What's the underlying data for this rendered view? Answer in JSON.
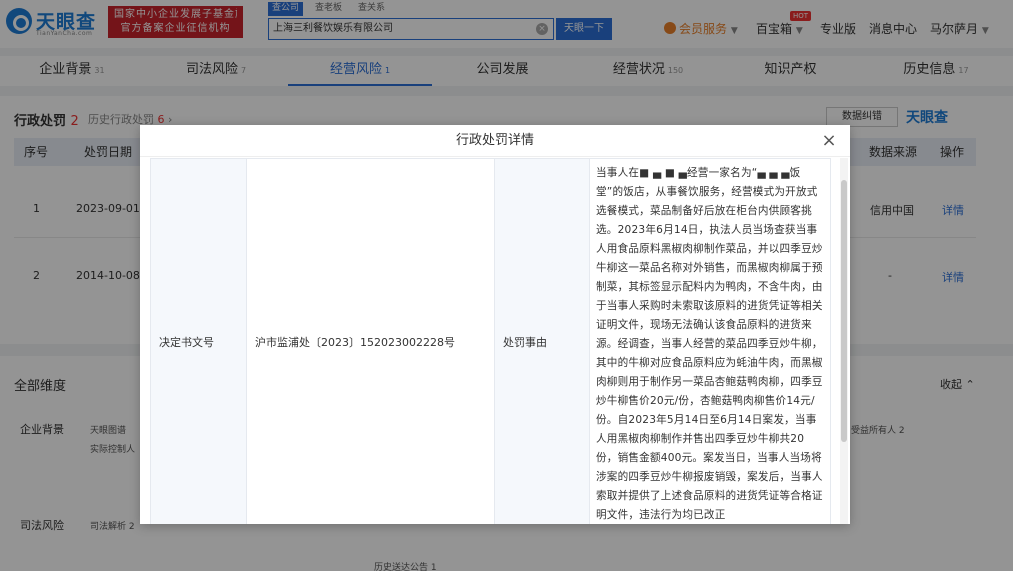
{
  "header": {
    "logo_text": "天眼查",
    "logo_sub": "TianYanCha.com",
    "banner_line1": "国家中小企业发展子基金旗下",
    "banner_line2": "官方备案企业征信机构",
    "search_tabs": [
      "查公司",
      "查老板",
      "查关系"
    ],
    "search_value": "上海三利餐饮娱乐有限公司",
    "search_button": "天眼一下",
    "vip_label": "会员服务",
    "treasure_label": "百宝箱",
    "hot_badge": "HOT",
    "pro_label": "专业版",
    "message_label": "消息中心",
    "user_name": "马尔萨月"
  },
  "main_tabs": [
    {
      "label": "企业背景",
      "count": "31"
    },
    {
      "label": "司法风险",
      "count": "7"
    },
    {
      "label": "经营风险",
      "count": "1"
    },
    {
      "label": "公司发展",
      "count": ""
    },
    {
      "label": "经营状况",
      "count": "150"
    },
    {
      "label": "知识产权",
      "count": ""
    },
    {
      "label": "历史信息",
      "count": "17"
    }
  ],
  "penalty_section": {
    "title": "行政处罚",
    "count": "2",
    "history_label": "历史行政处罚",
    "history_count": "6",
    "feedback_button": "数据纠错",
    "watermark": "天眼查",
    "columns": [
      "序号",
      "处罚日期",
      "数据来源",
      "操作"
    ],
    "rows": [
      {
        "index": "1",
        "date": "2023-09-01",
        "source": "信用中国",
        "action": "详情"
      },
      {
        "index": "2",
        "date": "2014-10-08",
        "source": "-",
        "action": "详情"
      }
    ]
  },
  "dimensions": {
    "title": "全部维度",
    "collapse_label": "收起",
    "categories": [
      "企业背景",
      "司法风险"
    ],
    "items_row1": [
      "天眼图谱",
      "实际控制人",
      "受益所有人 2"
    ],
    "items_row2": [
      "司法解析 2",
      "历史送达公告 1"
    ]
  },
  "modal": {
    "title": "行政处罚详情",
    "decision_label": "决定书文号",
    "decision_value": "沪市监浦处〔2023〕152023002228号",
    "reason_label": "处罚事由",
    "reason_text": "当事人在■ ▄ ■ ▄经营一家名为“▄ ▄ ▄饭堂”的饭店，从事餐饮服务，经营模式为开放式选餐模式，菜品制备好后放在柜台内供顾客挑选。2023年6月14日，执法人员当场查获当事人用食品原料黑椒肉柳制作菜品，并以四季豆炒牛柳这一菜品名称对外销售，而黑椒肉柳属于预制菜，其标签显示配料内为鸭肉，不含牛肉，由于当事人采购时未索取该原料的进货凭证等相关证明文件，现场无法确认该食品原料的进货来源。经调查，当事人经营的菜品四季豆炒牛柳，其中的牛柳对应食品原料应为蚝油牛肉，而黑椒肉柳则用于制作另一菜品杏鲍菇鸭肉柳，四季豆炒牛柳售价20元/份，杏鲍菇鸭肉柳售价14元/份。自2023年5月14日至6月14日案发，当事人用黑椒肉柳制作并售出四季豆炒牛柳共20份，销售金额400元。案发当日，当事人当场将涉案的四季豆炒牛柳报废销毁，案发后，当事人索取并提供了上述食品原料的进货凭证等合格证明文件，违法行为均已改正"
  }
}
